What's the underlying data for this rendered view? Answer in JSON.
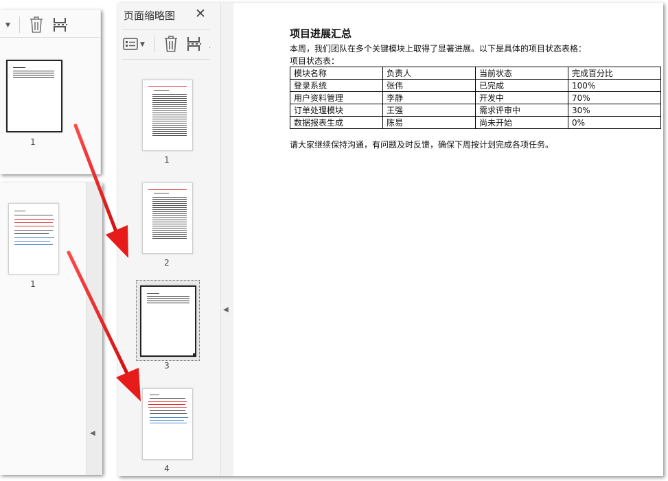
{
  "left_top": {
    "thumb_label": "1"
  },
  "left_bottom": {
    "thumb_label": "1"
  },
  "sidebar": {
    "title": "页面缩略图",
    "close_glyph": "✕",
    "thumbnails": [
      {
        "label": "1"
      },
      {
        "label": "2"
      },
      {
        "label": "3",
        "selected": true
      },
      {
        "label": "4"
      }
    ]
  },
  "document": {
    "title": "项目进展汇总",
    "intro": "本周，我们团队在多个关键模块上取得了显著进展。以下是具体的项目状态表格：",
    "table_label": "项目状态表：",
    "table": {
      "headers": [
        "模块名称",
        "负责人",
        "当前状态",
        "完成百分比"
      ],
      "rows": [
        [
          "登录系统",
          "张伟",
          "已完成",
          "100%"
        ],
        [
          "用户资料管理",
          "李静",
          "开发中",
          "70%"
        ],
        [
          "订单处理模块",
          "王强",
          "需求评审中",
          "30%"
        ],
        [
          "数据报表生成",
          "陈易",
          "尚未开始",
          "0%"
        ]
      ]
    },
    "footer": "请大家继续保持沟通，有问题及时反馈，确保下周按计划完成各项任务。"
  },
  "colors": {
    "arrow": "#e81b1b",
    "selection": "#555555"
  }
}
